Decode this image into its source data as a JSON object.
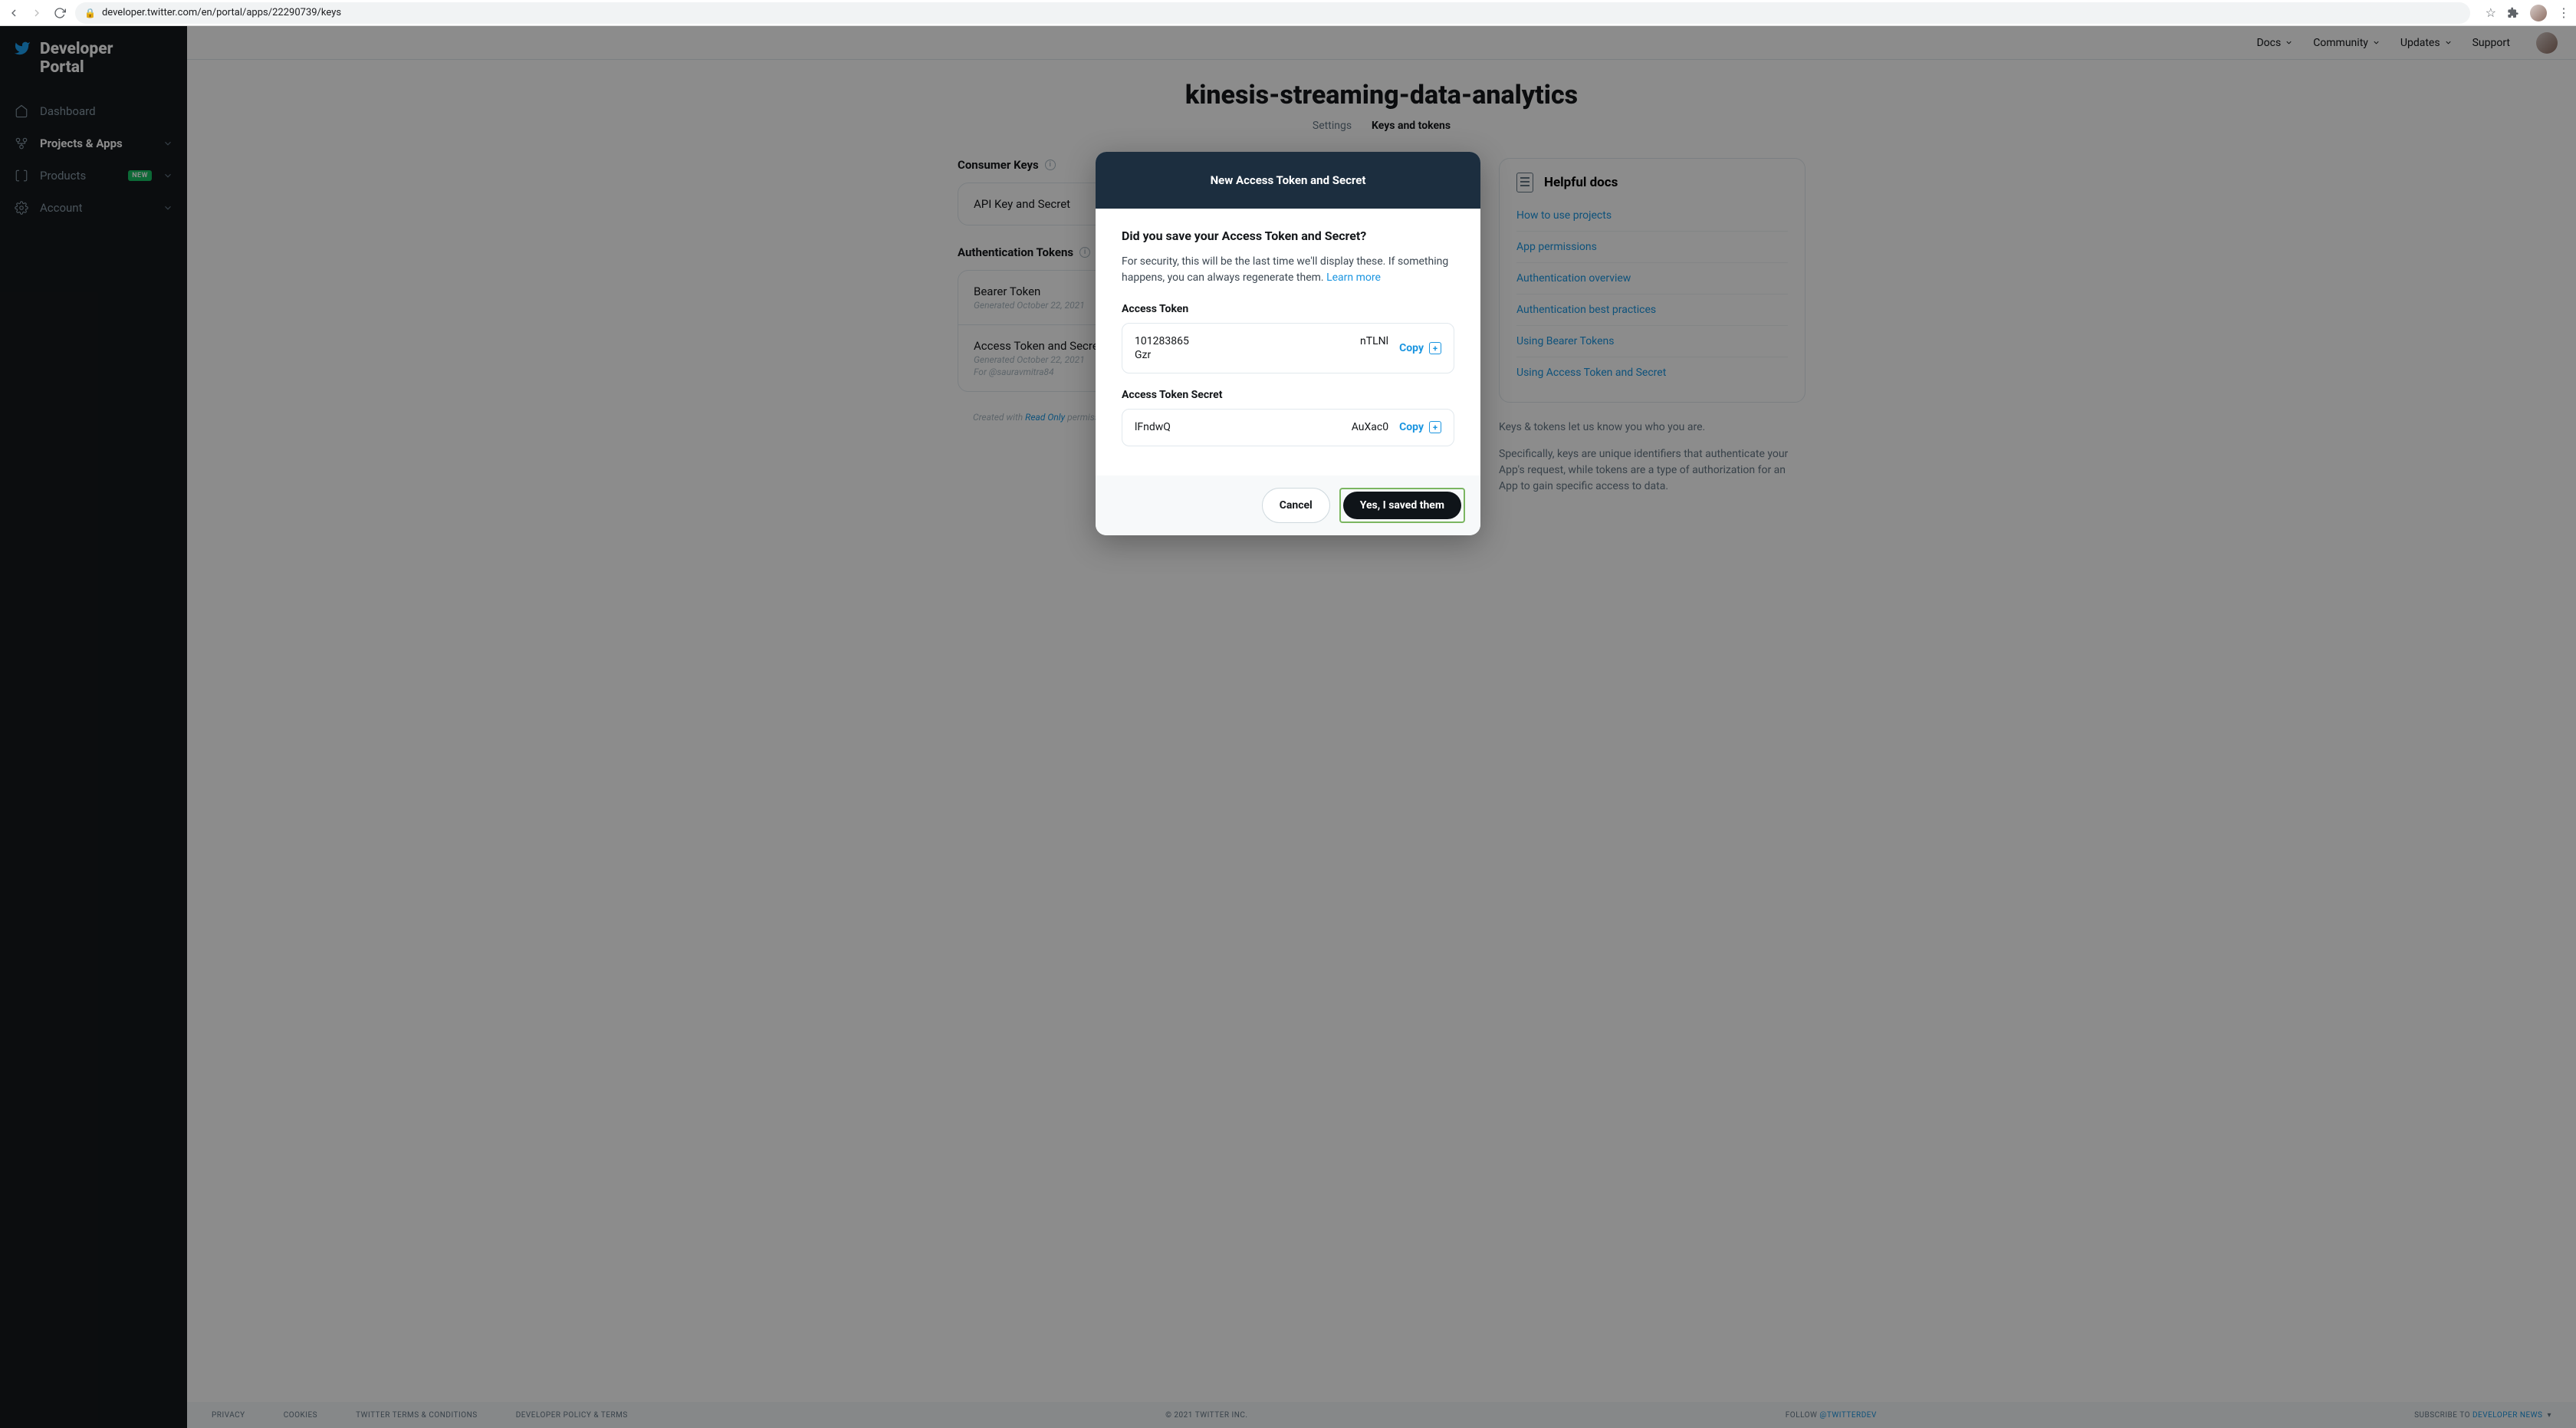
{
  "browser": {
    "url": "developer.twitter.com/en/portal/apps/22290739/keys"
  },
  "brand": {
    "line1": "Developer",
    "line2": "Portal"
  },
  "sidebar": {
    "dashboard": "Dashboard",
    "projects": "Projects & Apps",
    "products": "Products",
    "products_badge": "NEW",
    "account": "Account"
  },
  "topnav": {
    "docs": "Docs",
    "community": "Community",
    "updates": "Updates",
    "support": "Support"
  },
  "page": {
    "app_name": "kinesis-streaming-data-analytics",
    "tab_settings": "Settings",
    "tab_keys": "Keys and tokens",
    "consumer_keys": "Consumer Keys",
    "api_key_secret": "API Key and Secret",
    "auth_tokens": "Authentication Tokens",
    "bearer_token": "Bearer Token",
    "bearer_meta": "Generated October 22, 2021",
    "access_token_secret": "Access Token and Secret",
    "ats_meta1": "Generated October 22, 2021",
    "ats_meta2": "For @sauravmitra84",
    "created_with_pre": "Created with ",
    "created_with_link": "Read Only",
    "created_with_post": " permissions"
  },
  "help": {
    "title": "Helpful docs",
    "links": [
      "How to use projects",
      "App permissions",
      "Authentication overview",
      "Authentication best practices",
      "Using Bearer Tokens",
      "Using Access Token and Secret"
    ],
    "para1": "Keys & tokens let us know you who you are.",
    "para2194": "Specifically, keys are unique identifiers that authenticate your App's request, while tokens are a type of authorization for an App to gain specific access to data."
  },
  "footer": {
    "privacy": "PRIVACY",
    "cookies": "COOKIES",
    "twitter_terms": "TWITTER TERMS & CONDITIONS",
    "dev_policy": "DEVELOPER POLICY & TERMS",
    "copyright": "© 2021 TWITTER INC.",
    "follow": "FOLLOW ",
    "follow_handle": "@TWITTERDEV",
    "subscribe": "SUBSCRIBE TO ",
    "subscribe_link": "DEVELOPER NEWS"
  },
  "modal": {
    "title": "New Access Token and Secret",
    "question": "Did you save your Access Token and Secret?",
    "desc_pre": "For security, this will be the last time we'll display these. If something happens, you can always regenerate them. ",
    "learn_more": "Learn more",
    "access_token_label": "Access Token",
    "access_token_start": "101283865",
    "access_token_end": "nTLNl",
    "access_token_line2": "Gzr",
    "secret_label": "Access Token Secret",
    "secret_start": "lFndwQ",
    "secret_end": "AuXac0",
    "copy": "Copy",
    "cancel": "Cancel",
    "saved": "Yes, I saved them"
  }
}
